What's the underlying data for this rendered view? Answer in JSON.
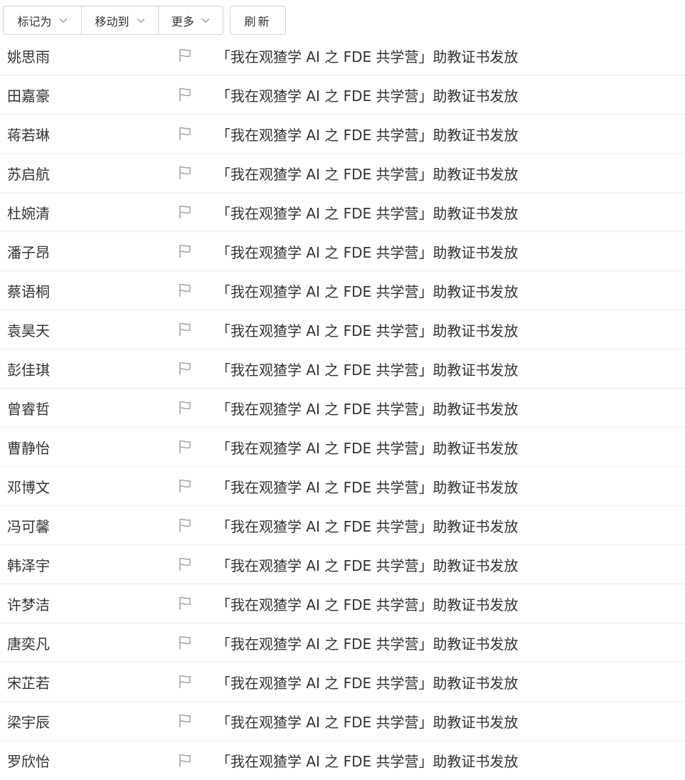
{
  "toolbar": {
    "mark_as": "标记为",
    "move_to": "移动到",
    "more": "更多",
    "refresh": "刷新"
  },
  "icons": {
    "dropdown": "chevron-down-icon",
    "flag": "flag-icon"
  },
  "colors": {
    "border": "#cfd3d9",
    "row_divider": "#e8eaed",
    "text": "#333333",
    "flag": "#a0a4aa"
  },
  "mails": [
    {
      "sender": "姚思雨",
      "subject": "「我在观猹学 AI 之 FDE 共学营」助教证书发放"
    },
    {
      "sender": "田嘉豪",
      "subject": "「我在观猹学 AI 之 FDE 共学营」助教证书发放"
    },
    {
      "sender": "蒋若琳",
      "subject": "「我在观猹学 AI 之 FDE 共学营」助教证书发放"
    },
    {
      "sender": "苏启航",
      "subject": "「我在观猹学 AI 之 FDE 共学营」助教证书发放"
    },
    {
      "sender": "杜婉清",
      "subject": "「我在观猹学 AI 之 FDE 共学营」助教证书发放"
    },
    {
      "sender": "潘子昂",
      "subject": "「我在观猹学 AI 之 FDE 共学营」助教证书发放"
    },
    {
      "sender": "蔡语桐",
      "subject": "「我在观猹学 AI 之 FDE 共学营」助教证书发放"
    },
    {
      "sender": "袁昊天",
      "subject": "「我在观猹学 AI 之 FDE 共学营」助教证书发放"
    },
    {
      "sender": "彭佳琪",
      "subject": "「我在观猹学 AI 之 FDE 共学营」助教证书发放"
    },
    {
      "sender": "曾睿哲",
      "subject": "「我在观猹学 AI 之 FDE 共学营」助教证书发放"
    },
    {
      "sender": "曹静怡",
      "subject": "「我在观猹学 AI 之 FDE 共学营」助教证书发放"
    },
    {
      "sender": "邓博文",
      "subject": "「我在观猹学 AI 之 FDE 共学营」助教证书发放"
    },
    {
      "sender": "冯可馨",
      "subject": "「我在观猹学 AI 之 FDE 共学营」助教证书发放"
    },
    {
      "sender": "韩泽宇",
      "subject": "「我在观猹学 AI 之 FDE 共学营」助教证书发放"
    },
    {
      "sender": "许梦洁",
      "subject": "「我在观猹学 AI 之 FDE 共学营」助教证书发放"
    },
    {
      "sender": "唐奕凡",
      "subject": "「我在观猹学 AI 之 FDE 共学营」助教证书发放"
    },
    {
      "sender": "宋芷若",
      "subject": "「我在观猹学 AI 之 FDE 共学营」助教证书发放"
    },
    {
      "sender": "梁宇辰",
      "subject": "「我在观猹学 AI 之 FDE 共学营」助教证书发放"
    },
    {
      "sender": "罗欣怡",
      "subject": "「我在观猹学 AI 之 FDE 共学营」助教证书发放"
    }
  ]
}
